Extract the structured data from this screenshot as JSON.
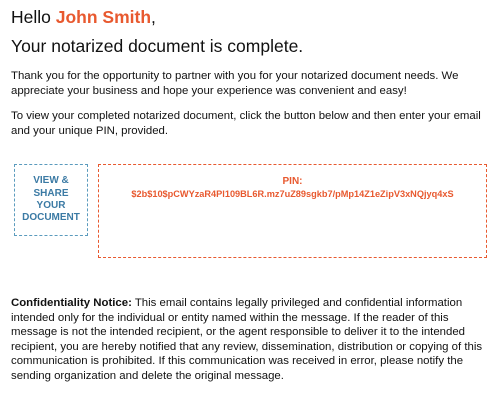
{
  "greeting": {
    "prefix": "Hello ",
    "name": "John Smith",
    "suffix": ","
  },
  "headline": "Your notarized document is complete.",
  "paragraphs": {
    "thanks": "Thank you for the opportunity to partner with you for your notarized document needs. We appreciate your business and hope your experience was convenient and easy!",
    "instructions": "To view your completed notarized document, click the button below and then enter your email and your unique PIN, provided."
  },
  "view_button": {
    "label": "VIEW &\nSHARE\nYOUR\nDOCUMENT"
  },
  "pin": {
    "label": "PIN:",
    "value": "$2b$10$pCWYzaR4Pl109BL6R.mz7uZ89sgkb7/pMp14Z1eZipV3xNQjyq4xS"
  },
  "notice": {
    "title": "Confidentiality Notice:",
    "body": " This email contains legally privileged and confidential information intended only for the individual or entity named within the message. If the reader of this message is not the intended recipient, or the agent responsible to deliver it to the intended recipient, you are hereby notified that any review, dissemination, distribution or copying of this communication is prohibited. If this communication was received in error, please notify the sending organization and delete the original message."
  },
  "colors": {
    "accent": "#e8592f",
    "button_border": "#5b9bbd",
    "button_text": "#3b7aa4",
    "text": "#111111"
  }
}
